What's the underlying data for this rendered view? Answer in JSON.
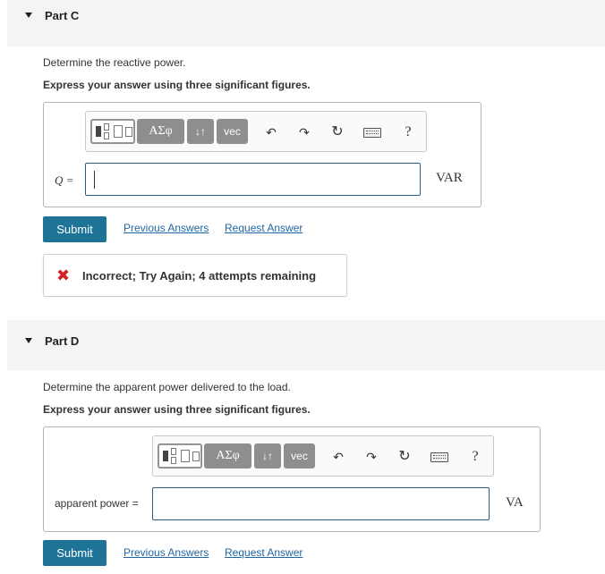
{
  "part_c": {
    "title": "Part C",
    "question": "Determine the reactive power.",
    "instruction": "Express your answer using three significant figures.",
    "toolbar": {
      "template_icons": "templates-icon",
      "greek_label": "ΑΣφ",
      "sort_label": "↓↑",
      "vec_label": "vec",
      "undo_icon": "↶",
      "redo_icon": "↷",
      "reset_icon": "↻",
      "keyboard_icon": "keyboard",
      "help_label": "?"
    },
    "variable_label": "Q =",
    "input_value": "",
    "unit": "VAR",
    "submit_label": "Submit",
    "previous_answers_label": "Previous Answers",
    "request_answer_label": "Request Answer",
    "feedback": {
      "icon": "✖",
      "text": "Incorrect; Try Again; 4 attempts remaining"
    }
  },
  "part_d": {
    "title": "Part D",
    "question": "Determine the apparent power delivered to the load.",
    "instruction": "Express your answer using three significant figures.",
    "toolbar": {
      "template_icons": "templates-icon",
      "greek_label": "ΑΣφ",
      "sort_label": "↓↑",
      "vec_label": "vec",
      "undo_icon": "↶",
      "redo_icon": "↷",
      "reset_icon": "↻",
      "keyboard_icon": "keyboard",
      "help_label": "?"
    },
    "variable_label": "apparent power =",
    "input_value": "",
    "unit": "VA",
    "submit_label": "Submit",
    "previous_answers_label": "Previous Answers",
    "request_answer_label": "Request Answer"
  },
  "colors": {
    "header_bg": "#f4f4f4",
    "submit_bg": "#1e7497",
    "link": "#1e66a4",
    "error": "#d42323",
    "input_border": "#2a5d84"
  }
}
